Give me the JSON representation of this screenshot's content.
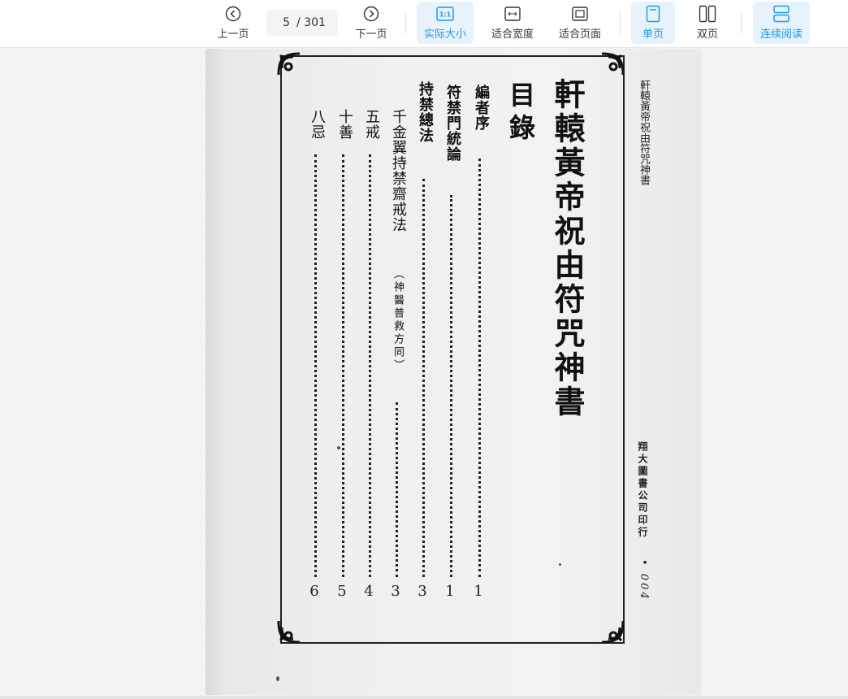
{
  "toolbar": {
    "prev_label": "上一页",
    "next_label": "下一页",
    "current_page": "5",
    "total_pages": "/ 301",
    "actual_size_label": "实际大小",
    "fit_width_label": "适合宽度",
    "fit_page_label": "适合页面",
    "single_page_label": "单页",
    "double_page_label": "双页",
    "continuous_label": "连续阅读",
    "accent_color": "#1a9be6",
    "active_bg": "#e6f3fc"
  },
  "document": {
    "book_title": "軒轅黃帝祝由符咒神書",
    "toc_heading": "目錄",
    "entries": [
      {
        "title": "編者序",
        "page": "1"
      },
      {
        "title": "符禁門統論",
        "page": "1"
      },
      {
        "title": "持禁總法",
        "page": "3"
      },
      {
        "title": "千金翼持禁齋戒法",
        "note": "（神醫普救方同）",
        "page": "3"
      },
      {
        "title": "五戒",
        "page": "4"
      },
      {
        "title": "十善",
        "page": "5"
      },
      {
        "title": "八忌",
        "page": "6"
      }
    ],
    "running_title": "軒轅黃帝祝由符咒神書",
    "publisher": "翔大圖書公司印行",
    "page_number": "• 004"
  }
}
